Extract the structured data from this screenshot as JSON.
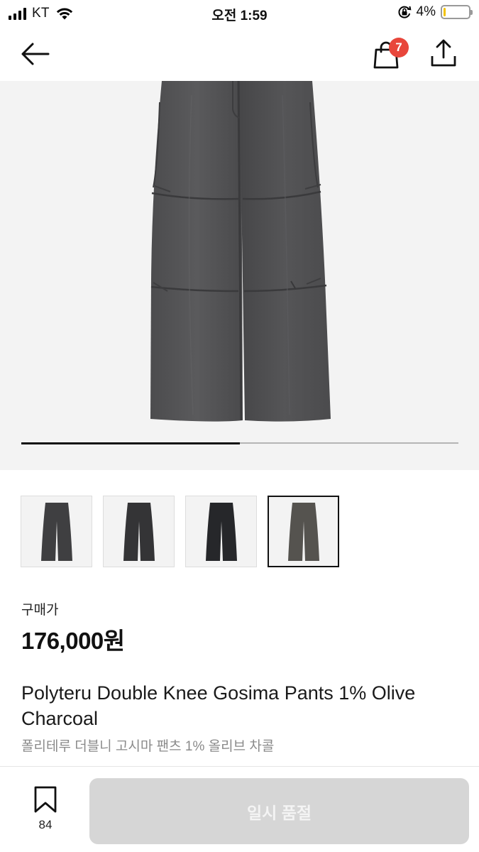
{
  "status_bar": {
    "carrier": "KT",
    "time": "오전 1:59",
    "battery_percent_label": "4%",
    "battery_level": 0.04,
    "battery_color": "#f2c200",
    "icons": [
      "signal-icon",
      "wifi-icon",
      "orientation-lock-icon",
      "battery-icon"
    ]
  },
  "nav": {
    "back_icon": "arrow-left-icon",
    "bag_icon": "shopping-bag-icon",
    "cart_count": "7",
    "badge_color": "#e8463b",
    "share_icon": "share-icon"
  },
  "gallery": {
    "image_count": 4,
    "current_index": 1,
    "progress": 0.5,
    "thumbnail_colors": [
      "#3f3f41",
      "#343436",
      "#26272a",
      "#55534f"
    ],
    "selected_thumbnail": 3
  },
  "product": {
    "price_label": "구매가",
    "price": "176,000원",
    "title": "Polyteru Double Knee Gosima Pants 1% Olive Charcoal",
    "subtitle": "폴리테루 더블니 고시마 팬츠 1% 올리브 차콜"
  },
  "bottom_bar": {
    "wish_icon": "bookmark-icon",
    "wish_count": "84",
    "soldout_label": "일시 품절"
  }
}
